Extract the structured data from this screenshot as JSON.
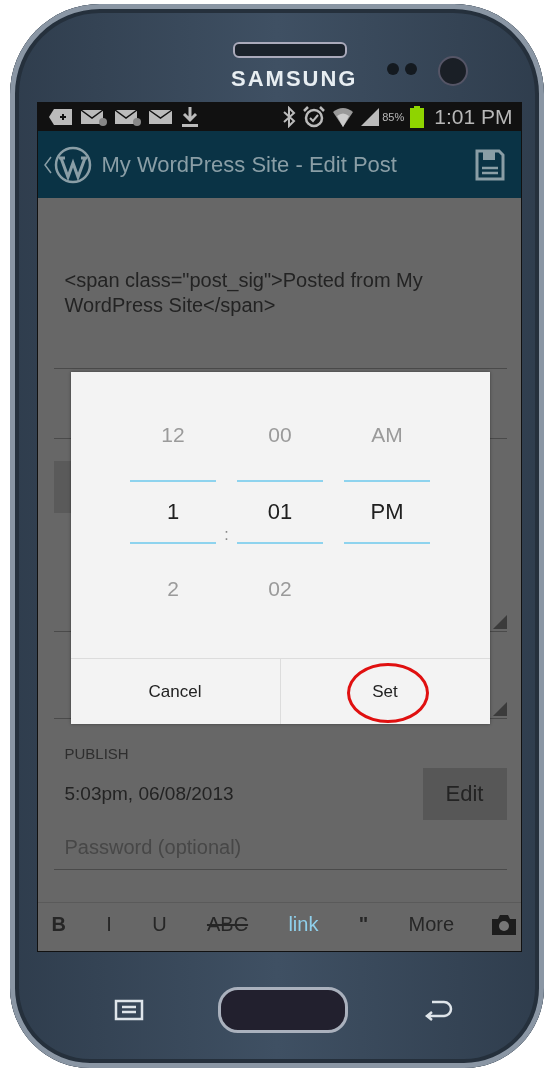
{
  "device": {
    "brand": "SAMSUNG"
  },
  "status_bar": {
    "battery_text": "85%",
    "time": "1:01 PM"
  },
  "app_bar": {
    "title": "My WordPress Site - Edit Post"
  },
  "post": {
    "content": "<span class=\"post_sig\">Posted from My WordPress Site</span>",
    "obscured_rows": [
      {
        "kind": "field"
      },
      {
        "kind": "button"
      },
      {
        "kind": "text"
      },
      {
        "kind": "label"
      },
      {
        "kind": "select"
      },
      {
        "kind": "label"
      },
      {
        "kind": "select"
      }
    ],
    "publish": {
      "label": "PUBLISH",
      "value": "5:03pm, 06/08/2013",
      "button": "Edit"
    },
    "password": {
      "placeholder": "Password (optional)"
    }
  },
  "format_toolbar": [
    {
      "label": "B",
      "kind": "bold"
    },
    {
      "label": "I",
      "kind": "italic"
    },
    {
      "label": "U",
      "kind": "underline"
    },
    {
      "label": "ABC",
      "kind": "strike"
    },
    {
      "label": "link",
      "kind": "link"
    },
    {
      "label": "\"",
      "kind": "quote"
    },
    {
      "label": "More",
      "kind": "more"
    }
  ],
  "time_dialog": {
    "columns": [
      {
        "above": "12",
        "value": "1",
        "below": "2"
      },
      {
        "above": "00",
        "value": "01",
        "below": "02"
      },
      {
        "above": "AM",
        "value": "PM"
      }
    ],
    "separator": ":",
    "buttons": [
      {
        "label": "Cancel",
        "circled": false
      },
      {
        "label": "Set",
        "circled": true
      }
    ]
  }
}
